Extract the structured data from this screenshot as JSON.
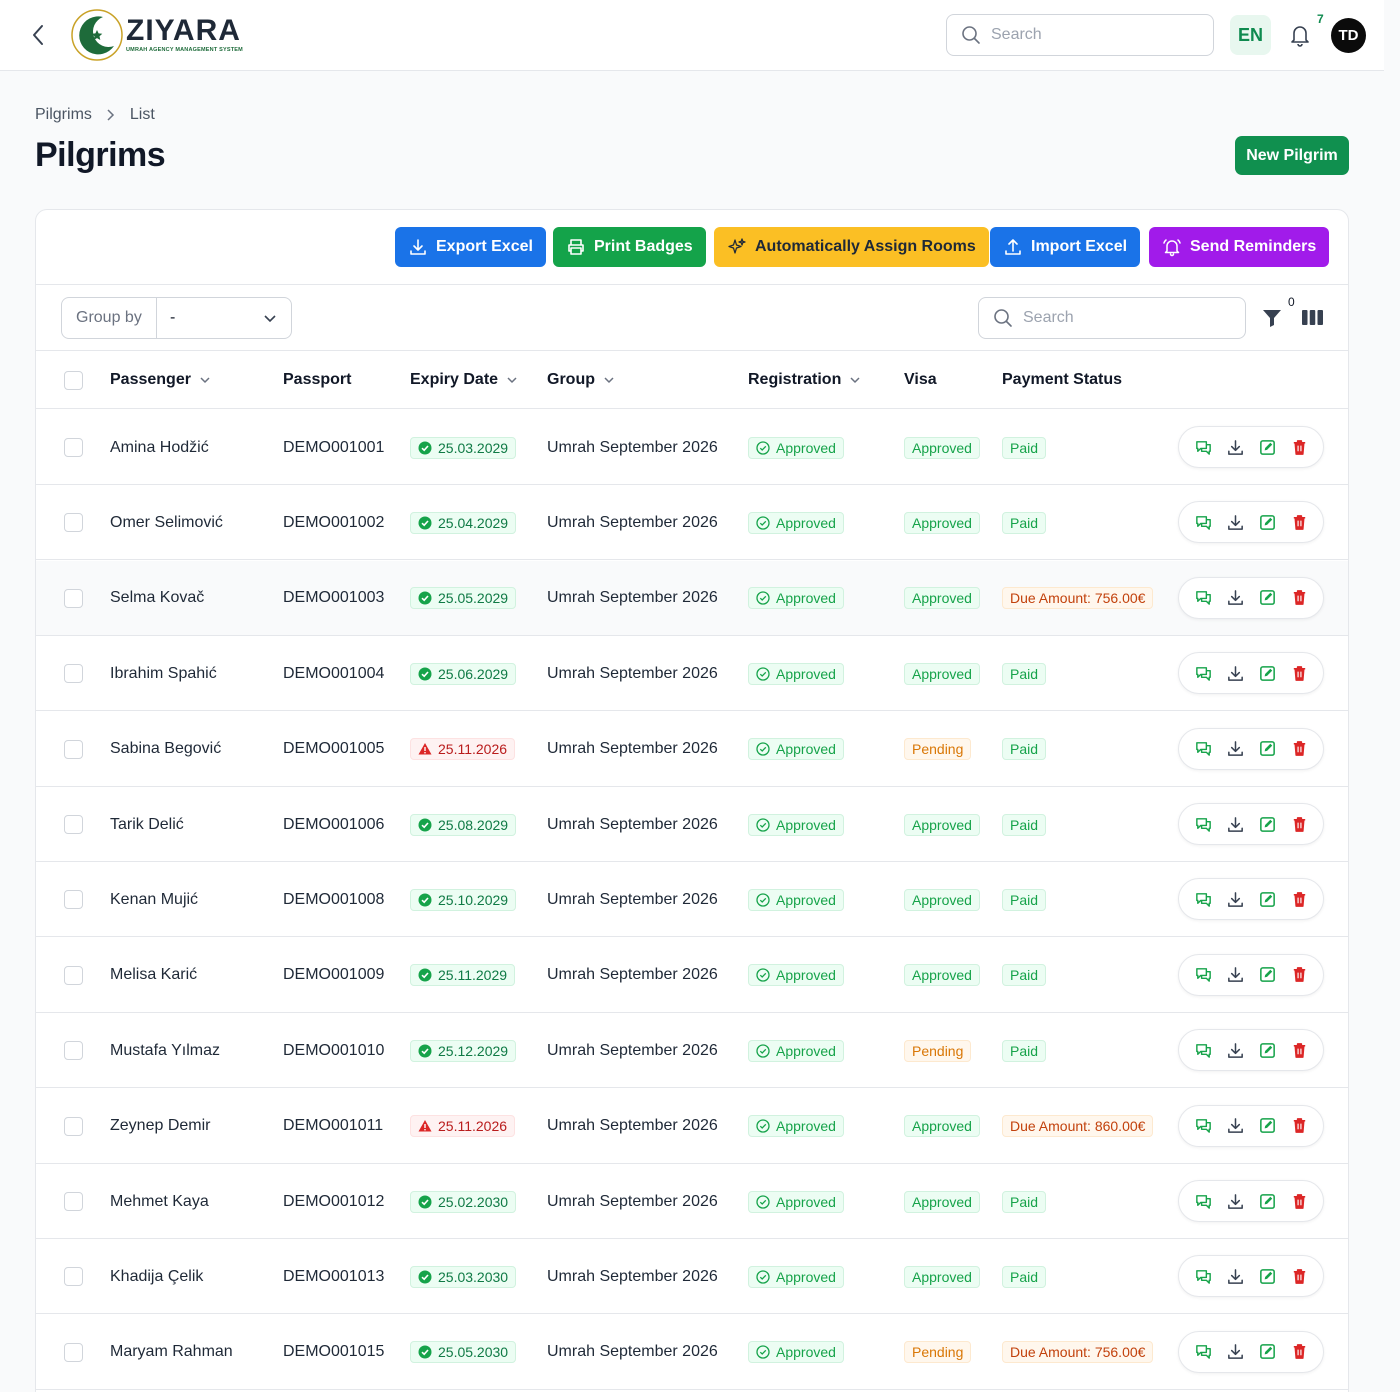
{
  "header": {
    "logo_title": "ZIYARA",
    "logo_subtitle": "UMRAH AGENCY MANAGEMENT SYSTEM",
    "search_placeholder": "Search",
    "language": "EN",
    "notification_count": "7",
    "avatar_initials": "TD"
  },
  "breadcrumb": {
    "root": "Pilgrims",
    "current": "List"
  },
  "page": {
    "title": "Pilgrims",
    "new_button": "New Pilgrim"
  },
  "actions": {
    "export_excel": "Export Excel",
    "print_badges": "Print Badges",
    "auto_assign_rooms": "Automatically Assign Rooms",
    "import_excel": "Import Excel",
    "send_reminders": "Send Reminders"
  },
  "colors": {
    "brand_green": "#10904f",
    "export_blue": "#1a73e8",
    "print_green": "#14a34a",
    "assign_yellow": "#fbbf24",
    "import_blue": "#1a73e8",
    "reminders_purple": "#a11bea",
    "danger_red": "#dc2626"
  },
  "filters": {
    "group_by_label": "Group by",
    "group_by_value": "-",
    "search_placeholder": "Search",
    "active_filter_count": "0"
  },
  "table": {
    "columns": {
      "passenger": "Passenger",
      "passport": "Passport",
      "expiry": "Expiry Date",
      "group": "Group",
      "registration": "Registration",
      "visa": "Visa",
      "payment": "Payment Status"
    },
    "rows": [
      {
        "passenger": "Amina Hodžić",
        "passport": "DEMO001001",
        "expiry": "25.03.2029",
        "expiry_ok": true,
        "group": "Umrah September 2026",
        "registration": "Approved",
        "visa": "Approved",
        "payment": "Paid"
      },
      {
        "passenger": "Omer Selimović",
        "passport": "DEMO001002",
        "expiry": "25.04.2029",
        "expiry_ok": true,
        "group": "Umrah September 2026",
        "registration": "Approved",
        "visa": "Approved",
        "payment": "Paid"
      },
      {
        "passenger": "Selma Kovač",
        "passport": "DEMO001003",
        "expiry": "25.05.2029",
        "expiry_ok": true,
        "group": "Umrah September 2026",
        "registration": "Approved",
        "visa": "Approved",
        "payment": "Due Amount: 756.00€"
      },
      {
        "passenger": "Ibrahim Spahić",
        "passport": "DEMO001004",
        "expiry": "25.06.2029",
        "expiry_ok": true,
        "group": "Umrah September 2026",
        "registration": "Approved",
        "visa": "Approved",
        "payment": "Paid"
      },
      {
        "passenger": "Sabina Begović",
        "passport": "DEMO001005",
        "expiry": "25.11.2026",
        "expiry_ok": false,
        "group": "Umrah September 2026",
        "registration": "Approved",
        "visa": "Pending",
        "payment": "Paid"
      },
      {
        "passenger": "Tarik Delić",
        "passport": "DEMO001006",
        "expiry": "25.08.2029",
        "expiry_ok": true,
        "group": "Umrah September 2026",
        "registration": "Approved",
        "visa": "Approved",
        "payment": "Paid"
      },
      {
        "passenger": "Kenan Mujić",
        "passport": "DEMO001008",
        "expiry": "25.10.2029",
        "expiry_ok": true,
        "group": "Umrah September 2026",
        "registration": "Approved",
        "visa": "Approved",
        "payment": "Paid"
      },
      {
        "passenger": "Melisa Karić",
        "passport": "DEMO001009",
        "expiry": "25.11.2029",
        "expiry_ok": true,
        "group": "Umrah September 2026",
        "registration": "Approved",
        "visa": "Approved",
        "payment": "Paid"
      },
      {
        "passenger": "Mustafa Yılmaz",
        "passport": "DEMO001010",
        "expiry": "25.12.2029",
        "expiry_ok": true,
        "group": "Umrah September 2026",
        "registration": "Approved",
        "visa": "Pending",
        "payment": "Paid"
      },
      {
        "passenger": "Zeynep Demir",
        "passport": "DEMO001011",
        "expiry": "25.11.2026",
        "expiry_ok": false,
        "group": "Umrah September 2026",
        "registration": "Approved",
        "visa": "Approved",
        "payment": "Due Amount: 860.00€"
      },
      {
        "passenger": "Mehmet Kaya",
        "passport": "DEMO001012",
        "expiry": "25.02.2030",
        "expiry_ok": true,
        "group": "Umrah September 2026",
        "registration": "Approved",
        "visa": "Approved",
        "payment": "Paid"
      },
      {
        "passenger": "Khadija Çelik",
        "passport": "DEMO001013",
        "expiry": "25.03.2030",
        "expiry_ok": true,
        "group": "Umrah September 2026",
        "registration": "Approved",
        "visa": "Approved",
        "payment": "Paid"
      },
      {
        "passenger": "Maryam Rahman",
        "passport": "DEMO001015",
        "expiry": "25.05.2030",
        "expiry_ok": true,
        "group": "Umrah September 2026",
        "registration": "Approved",
        "visa": "Pending",
        "payment": "Due Amount: 756.00€"
      }
    ]
  }
}
